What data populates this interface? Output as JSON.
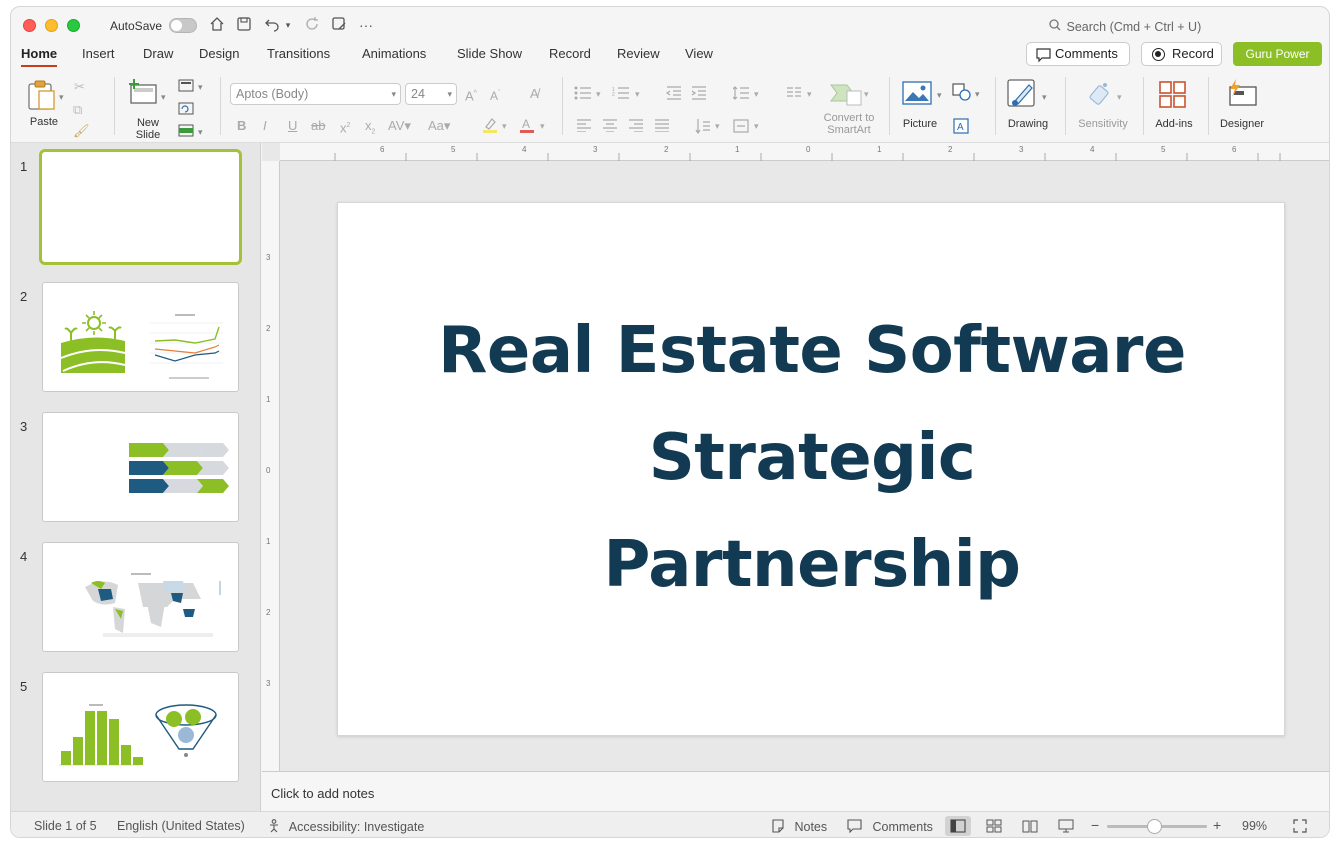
{
  "titlebar": {
    "autosave_label": "AutoSave",
    "search_placeholder": "Search (Cmd + Ctrl + U)"
  },
  "tabs": [
    "Home",
    "Insert",
    "Draw",
    "Design",
    "Transitions",
    "Animations",
    "Slide Show",
    "Record",
    "Review",
    "View"
  ],
  "active_tab": "Home",
  "header_buttons": {
    "comments": "Comments",
    "record": "Record",
    "guru": "Guru Power"
  },
  "ribbon": {
    "paste": "Paste",
    "new_slide_line1": "New",
    "new_slide_line2": "Slide",
    "font_name": "Aptos (Body)",
    "font_size": "24",
    "smartart_line1": "Convert to",
    "smartart_line2": "SmartArt",
    "picture": "Picture",
    "drawing": "Drawing",
    "sensitivity": "Sensitivity",
    "addins": "Add-ins",
    "designer": "Designer"
  },
  "thumbnails": [
    {
      "number": "1"
    },
    {
      "number": "2"
    },
    {
      "number": "3"
    },
    {
      "number": "4"
    },
    {
      "number": "5"
    }
  ],
  "slide": {
    "title_line1": "Real Estate Software",
    "title_line2": "Strategic",
    "title_line3": "Partnership"
  },
  "notes_placeholder": "Click to add notes",
  "status": {
    "slide_indicator": "Slide 1 of 5",
    "language": "English (United States)",
    "accessibility": "Accessibility: Investigate",
    "notes": "Notes",
    "comments": "Comments",
    "zoom": "99%"
  },
  "colors": {
    "brand_green": "#8cbf26",
    "title_navy": "#123a52",
    "accent_tab": "#c43e1c",
    "thumb_blue": "#1f5b80"
  }
}
